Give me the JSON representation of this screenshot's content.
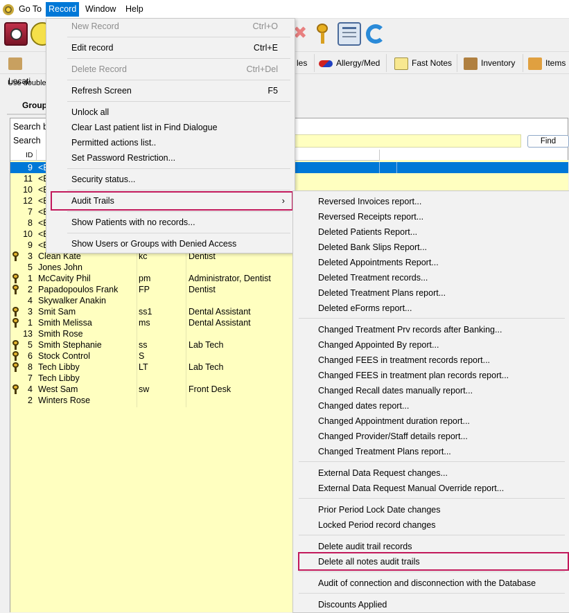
{
  "menubar": {
    "items": [
      {
        "label": "Go To"
      },
      {
        "label": "Record"
      },
      {
        "label": "Window"
      },
      {
        "label": "Help"
      }
    ]
  },
  "tabs": [
    {
      "label": "Locati"
    },
    {
      "label": "les"
    },
    {
      "label": "Allergy/Med"
    },
    {
      "label": "Fast Notes"
    },
    {
      "label": "Inventory"
    },
    {
      "label": "Items"
    }
  ],
  "hint_text": "Use double",
  "group_label": "Group",
  "search_by_label": "Search b",
  "search_label": "Search",
  "find_button": "Find",
  "grid": {
    "id_header": "ID",
    "rows": [
      {
        "id": "9",
        "name": "<E",
        "login": "",
        "role": "",
        "key": false,
        "selected": true
      },
      {
        "id": "11",
        "name": "<E",
        "login": "",
        "role": "",
        "key": false
      },
      {
        "id": "10",
        "name": "<E",
        "login": "",
        "role": "",
        "key": false
      },
      {
        "id": "12",
        "name": "<E",
        "login": "",
        "role": "",
        "key": false
      },
      {
        "id": "7",
        "name": "<E",
        "login": "",
        "role": "",
        "key": false
      },
      {
        "id": "8",
        "name": "<E",
        "login": "",
        "role": "",
        "key": false
      },
      {
        "id": "10",
        "name": "<E",
        "login": "",
        "role": "",
        "key": false
      },
      {
        "id": "9",
        "name": "<E",
        "login": "",
        "role": "",
        "key": false
      },
      {
        "id": "3",
        "name": "Clean Kate",
        "login": "kc",
        "role": "Dentist",
        "key": true
      },
      {
        "id": "5",
        "name": "Jones John",
        "login": "",
        "role": "",
        "key": false
      },
      {
        "id": "1",
        "name": "McCavity Phil",
        "login": "pm",
        "role": "Administrator, Dentist",
        "key": true
      },
      {
        "id": "2",
        "name": "Papadopoulos Frank",
        "login": "FP",
        "role": "Dentist",
        "key": true
      },
      {
        "id": "4",
        "name": "Skywalker Anakin",
        "login": "",
        "role": "",
        "key": false
      },
      {
        "id": "3",
        "name": "Smit Sam",
        "login": "ss1",
        "role": "Dental Assistant",
        "key": true
      },
      {
        "id": "1",
        "name": "Smith Melissa",
        "login": "ms",
        "role": "Dental Assistant",
        "key": true
      },
      {
        "id": "13",
        "name": "Smith Rose",
        "login": "",
        "role": "",
        "key": false
      },
      {
        "id": "5",
        "name": "Smith Stephanie",
        "login": "ss",
        "role": "Lab Tech",
        "key": true
      },
      {
        "id": "6",
        "name": "Stock  Control",
        "login": "S",
        "role": "",
        "key": true
      },
      {
        "id": "8",
        "name": "Tech Libby",
        "login": "LT",
        "role": "Lab Tech",
        "key": true
      },
      {
        "id": "7",
        "name": "Tech Libby",
        "login": "",
        "role": "",
        "key": false
      },
      {
        "id": "4",
        "name": "West Sam",
        "login": "sw",
        "role": "Front Desk",
        "key": true
      },
      {
        "id": "2",
        "name": "Winters Rose",
        "login": "",
        "role": "",
        "key": false
      }
    ]
  },
  "record_menu": {
    "items": [
      {
        "label": "New Record",
        "shortcut": "Ctrl+O",
        "disabled": true
      },
      {
        "label": "Edit record",
        "shortcut": "Ctrl+E",
        "disabled": false
      },
      {
        "label": "Delete Record",
        "shortcut": "Ctrl+Del",
        "disabled": true
      },
      {
        "label": "Refresh Screen",
        "shortcut": "F5",
        "disabled": false
      },
      {
        "label": "Unlock all",
        "shortcut": "",
        "disabled": false
      },
      {
        "label": "Clear Last patient list in Find Dialogue",
        "shortcut": "",
        "disabled": false
      },
      {
        "label": "Permitted actions list..",
        "shortcut": "",
        "disabled": false
      },
      {
        "label": "Set Password Restriction...",
        "shortcut": "",
        "disabled": false
      },
      {
        "label": "Security status...",
        "shortcut": "",
        "disabled": false
      },
      {
        "label": "Audit Trails",
        "shortcut": "",
        "disabled": false,
        "submenu": true
      },
      {
        "label": "Show Patients with no records...",
        "shortcut": "",
        "disabled": false
      },
      {
        "label": "Show Users or Groups with Denied Access",
        "shortcut": "",
        "disabled": false
      }
    ]
  },
  "audit_submenu": {
    "items": [
      {
        "label": "Reversed Invoices report..."
      },
      {
        "label": "Reversed Receipts report..."
      },
      {
        "label": "Deleted Patients Report..."
      },
      {
        "label": "Deleted Bank Slips Report..."
      },
      {
        "label": "Deleted Appointments Report..."
      },
      {
        "label": "Deleted Treatment records..."
      },
      {
        "label": "Deleted Treatment Plans report..."
      },
      {
        "label": "Deleted eForms report..."
      },
      {
        "label": "Changed Treatment Prv records after Banking..."
      },
      {
        "label": "Changed Appointed By report..."
      },
      {
        "label": "Changed FEES in treatment records report..."
      },
      {
        "label": "Changed FEES in treatment plan records report..."
      },
      {
        "label": "Changed Recall dates manually report..."
      },
      {
        "label": "Changed dates report..."
      },
      {
        "label": "Changed Appointment duration report..."
      },
      {
        "label": "Changed Provider/Staff details report..."
      },
      {
        "label": "Changed Treatment Plans report..."
      },
      {
        "label": "External Data Request changes..."
      },
      {
        "label": "External Data Request Manual Override report..."
      },
      {
        "label": "Prior Period Lock Date changes"
      },
      {
        "label": "Locked Period record changes"
      },
      {
        "label": "Delete audit trail records"
      },
      {
        "label": "Delete all notes audit trails"
      },
      {
        "label": "Audit of connection and disconnection with the Database"
      },
      {
        "label": "Discounts Applied"
      }
    ]
  },
  "colors": {
    "highlight_border": "#c2185b",
    "selection": "#0078d7",
    "grid_background": "#ffffc0"
  }
}
